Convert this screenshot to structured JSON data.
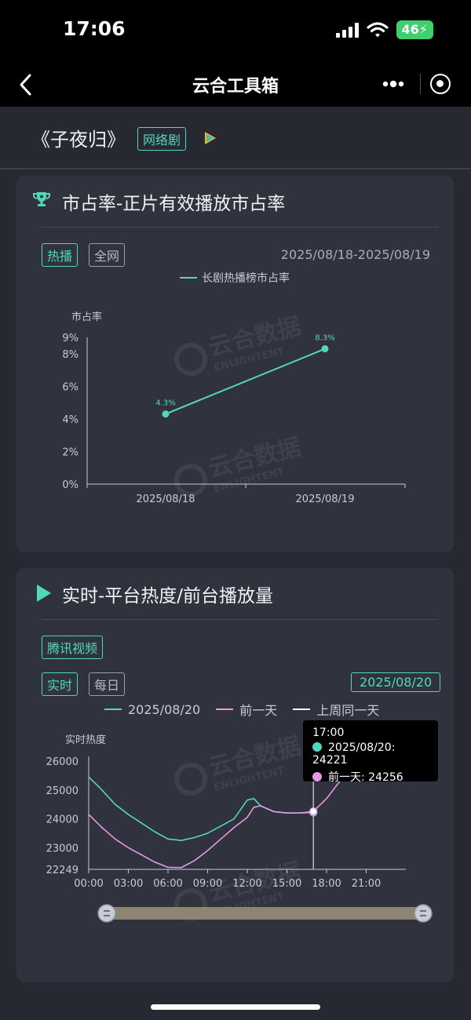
{
  "status_bar": {
    "time": "17:06",
    "battery": "46"
  },
  "nav": {
    "title": "云合工具箱",
    "icons": [
      "back-icon",
      "more-icon",
      "record-icon"
    ]
  },
  "show": {
    "title": "《子夜归》",
    "tag": "网络剧",
    "platform_icon": "tencent-video-icon"
  },
  "card1": {
    "icon": "trophy-icon",
    "title": "市占率-正片有效播放市占率",
    "tab_active": "热播",
    "tab_inactive": "全网",
    "date_range": "2025/08/18-2025/08/19",
    "legend": "长剧热播榜市占率",
    "y_axis_label": "市占率"
  },
  "card2": {
    "icon": "play-icon",
    "title": "实时-平台热度/前台播放量",
    "platform_tag": "腾讯视频",
    "tab_active": "实时",
    "tab_inactive": "每日",
    "date_button": "2025/08/20",
    "legend": [
      "2025/08/20",
      "前一天",
      "上周同一天"
    ],
    "y_axis_label": "实时热度",
    "tooltip": {
      "time": "17:00",
      "line1": "2025/08/20: 24221",
      "line2": "前一天: 24256"
    }
  },
  "watermark": {
    "cn": "云合数据",
    "en": "ENLIGHTENT"
  },
  "colors": {
    "accent": "#52d8bd",
    "prev_day": "#e59ae9",
    "last_week": "#ffffff",
    "card_bg": "#30323d"
  },
  "chart_data": [
    {
      "type": "line",
      "x": [
        "2025/08/18",
        "2025/08/19"
      ],
      "series": [
        {
          "name": "长剧热播榜市占率",
          "values": [
            4.3,
            8.3
          ]
        }
      ],
      "data_labels": [
        "4.3%",
        "8.3%"
      ],
      "ylabel": "市占率",
      "y_ticks": [
        "0%",
        "2%",
        "4%",
        "6%",
        "8%",
        "9%"
      ],
      "ylim": [
        0,
        9
      ]
    },
    {
      "type": "line",
      "x_ticks": [
        "00:00",
        "03:00",
        "06:00",
        "09:00",
        "12:00",
        "15:00",
        "18:00",
        "21:00"
      ],
      "y_ticks": [
        "22249",
        "23000",
        "24000",
        "25000",
        "26000"
      ],
      "ylim": [
        22249,
        26000
      ],
      "ylabel": "实时热度",
      "x_hours": [
        0,
        1,
        2,
        3,
        4,
        5,
        6,
        7,
        8,
        9,
        10,
        11,
        12,
        12.5,
        13,
        14,
        15,
        16,
        17,
        18,
        19,
        20
      ],
      "series": [
        {
          "name": "2025/08/20",
          "values": [
            25450,
            25000,
            24500,
            24150,
            23850,
            23550,
            23300,
            23250,
            23350,
            23500,
            23750,
            24000,
            24650,
            24700,
            24450,
            24250,
            24200,
            24200,
            24221,
            null,
            null,
            null
          ]
        },
        {
          "name": "前一天",
          "values": [
            24150,
            23700,
            23300,
            23000,
            22750,
            22500,
            22320,
            22310,
            22550,
            22900,
            23300,
            23700,
            24050,
            24400,
            24450,
            24250,
            24200,
            24200,
            24256,
            24700,
            25300,
            25900
          ]
        }
      ],
      "highlight": {
        "x": 17,
        "label": "17:00"
      }
    }
  ]
}
